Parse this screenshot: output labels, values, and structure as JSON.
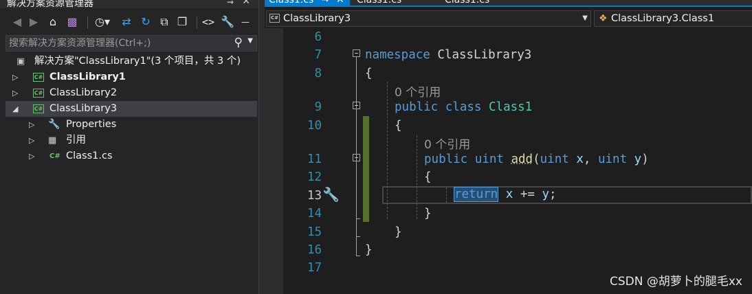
{
  "solution_explorer": {
    "title": "解决方案资源管理器",
    "search_placeholder": "搜索解决方案资源管理器(Ctrl+;)",
    "tree": [
      {
        "label": "解决方案\"ClassLibrary1\"(3 个项目，共 3 个)",
        "icon": "solution-icon",
        "level": 0
      },
      {
        "label": "ClassLibrary1",
        "icon": "csharp-project-icon",
        "level": 0,
        "expanded": false,
        "bold": true
      },
      {
        "label": "ClassLibrary2",
        "icon": "csharp-project-icon",
        "level": 0,
        "expanded": false
      },
      {
        "label": "ClassLibrary3",
        "icon": "csharp-project-icon",
        "level": 0,
        "expanded": true,
        "selected": true
      },
      {
        "label": "Properties",
        "icon": "wrench-icon",
        "level": 1
      },
      {
        "label": "引用",
        "icon": "references-icon",
        "level": 1
      },
      {
        "label": "Class1.cs",
        "icon": "csharp-file-icon",
        "level": 1
      }
    ]
  },
  "editor": {
    "tabs": [
      {
        "label": "Class1.cs",
        "active": true
      },
      {
        "label": "Class1.cs",
        "active": false
      },
      {
        "label": "Class1.cs",
        "active": false
      }
    ],
    "nav_left": "ClassLibrary3",
    "nav_right": "ClassLibrary3.Class1",
    "line_numbers": [
      "6",
      "7",
      "8",
      "9",
      "10",
      "11",
      "12",
      "13",
      "14",
      "15",
      "16",
      "17"
    ],
    "current_line": "13",
    "code": {
      "kw_namespace": "namespace",
      "ns_name": "ClassLibrary3",
      "brace_open": "{",
      "brace_close": "}",
      "refs1": "0 个引用",
      "kw_public": "public",
      "kw_class": "class",
      "class_name": "Class1",
      "refs2": "0 个引用",
      "kw_uint": "uint",
      "method_name": "add",
      "paren_open": "(",
      "param_x": "x",
      "comma": ",",
      "param_y": "y",
      "paren_close": ")",
      "kw_return": "return",
      "stmt_rest": " += ",
      "semicolon": ";"
    }
  },
  "watermark": "CSDN @胡萝卜的腿毛xx",
  "colors": {
    "keyword": "#569cd6",
    "type": "#4ec9b0",
    "method": "#dcdcaa",
    "parameter": "#9cdcfe",
    "line_number": "#2b91af",
    "accent": "#007acc",
    "change_bar": "#57712d"
  }
}
